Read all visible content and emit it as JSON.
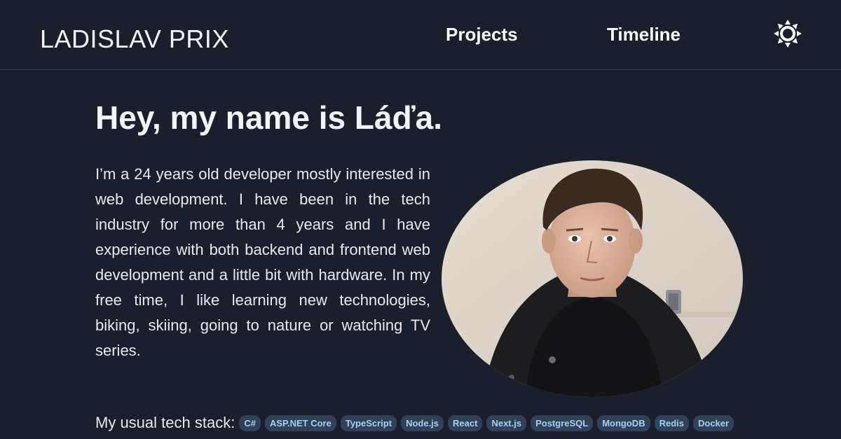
{
  "header": {
    "brand": "LADISLAV PRIX",
    "nav": [
      {
        "label": "Projects"
      },
      {
        "label": "Timeline"
      }
    ],
    "theme_toggle_icon": "sun-icon"
  },
  "main": {
    "title": "Hey, my name is Láďa.",
    "bio": "I’m a 24 years old developer mostly interested in web development. I have been in the tech industry for more than 4 years and I have experience with both backend and frontend web development and a little bit with hardware. In my free time, I like learning new technologies, biking, skiing, going to nature or watching TV series.",
    "photo_alt": "Portrait photo",
    "tech_stack": {
      "label": "My usual tech stack:",
      "items": [
        "C#",
        "ASP.NET Core",
        "TypeScript",
        "Node.js",
        "React",
        "Next.js",
        "PostgreSQL",
        "MongoDB",
        "Redis",
        "Docker"
      ]
    }
  },
  "colors": {
    "background": "#1b1f2b",
    "chip_bg": "#2f4257",
    "chip_text": "#a9cff0",
    "text": "#eef0f4"
  }
}
